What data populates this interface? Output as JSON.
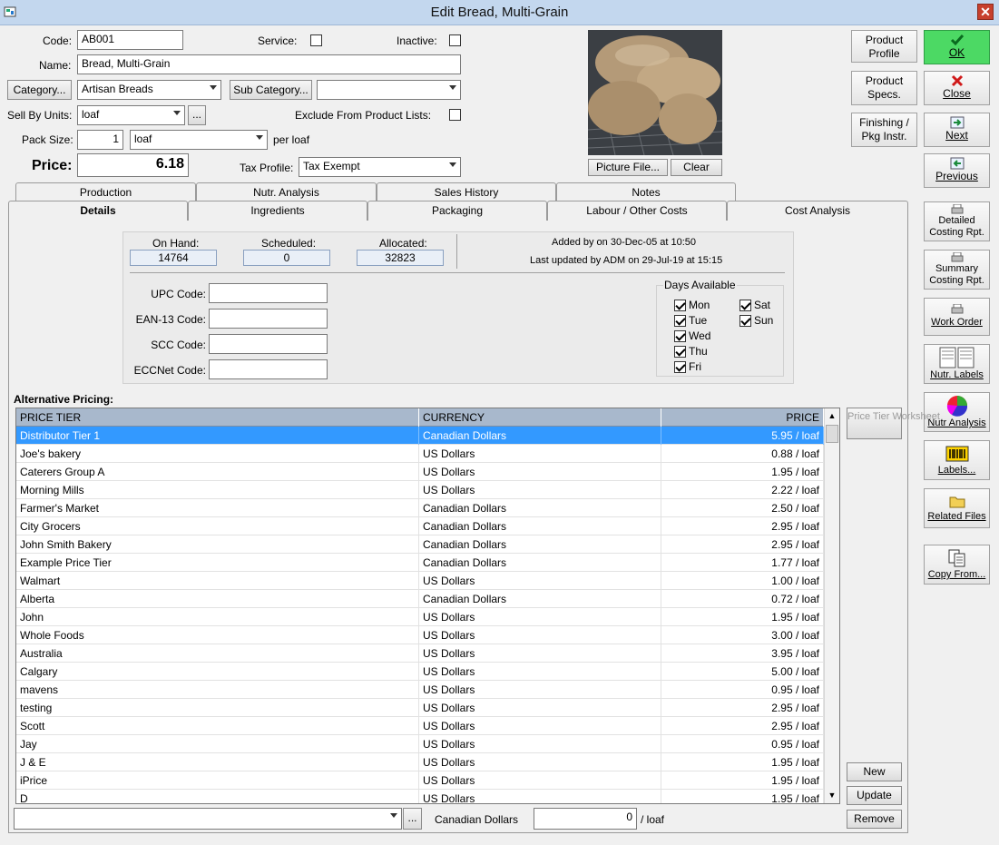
{
  "window": {
    "title": "Edit Bread, Multi-Grain",
    "close_glyph": "✕"
  },
  "form": {
    "code_label": "Code:",
    "code_value": "AB001",
    "service_label": "Service:",
    "inactive_label": "Inactive:",
    "name_label": "Name:",
    "name_value": "Bread, Multi-Grain",
    "category_button": "Category...",
    "category_value": "Artisan Breads",
    "subcategory_button": "Sub Category...",
    "subcategory_value": "",
    "sell_by_label": "Sell By Units:",
    "sell_by_value": "loaf",
    "ellipsis": "...",
    "exclude_label": "Exclude From Product Lists:",
    "pack_size_label": "Pack Size:",
    "pack_size_value": "1",
    "pack_unit_value": "loaf",
    "per_label": "per loaf",
    "price_label": "Price:",
    "price_value": "6.18",
    "tax_label": "Tax Profile:",
    "tax_value": "Tax Exempt",
    "picture_file_button": "Picture File...",
    "clear_button": "Clear"
  },
  "actions": {
    "product_profile": "Product Profile",
    "product_specs": "Product Specs.",
    "finishing": "Finishing / Pkg Instr.",
    "ok": "OK",
    "close": "Close",
    "next": "Next",
    "previous": "Previous",
    "detailed_costing": "Detailed Costing Rpt.",
    "summary_costing": "Summary Costing Rpt.",
    "work_order": "Work Order",
    "nutr_labels": "Nutr. Labels",
    "nutr_analysis": "Nutr Analysis",
    "labels": "Labels...",
    "related_files": "Related Files",
    "copy_from": "Copy From..."
  },
  "tabs_back": [
    "Production",
    "Nutr. Analysis",
    "Sales History",
    "Notes"
  ],
  "tabs_front": [
    "Details",
    "Ingredients",
    "Packaging",
    "Labour / Other Costs",
    "Cost Analysis"
  ],
  "details": {
    "on_hand_label": "On Hand:",
    "on_hand_value": "14764",
    "scheduled_label": "Scheduled:",
    "scheduled_value": "0",
    "allocated_label": "Allocated:",
    "allocated_value": "32823",
    "added_text": "Added by  on 30-Dec-05 at 10:50",
    "updated_text": "Last updated by ADM on 29-Jul-19 at 15:15",
    "upc_label": "UPC Code:",
    "ean_label": "EAN-13 Code:",
    "scc_label": "SCC Code:",
    "eccnet_label": "ECCNet Code:",
    "days_title": "Days Available",
    "days": [
      {
        "label": "Mon",
        "checked": true
      },
      {
        "label": "Tue",
        "checked": true
      },
      {
        "label": "Wed",
        "checked": true
      },
      {
        "label": "Thu",
        "checked": true
      },
      {
        "label": "Fri",
        "checked": true
      },
      {
        "label": "Sat",
        "checked": true
      },
      {
        "label": "Sun",
        "checked": true
      }
    ]
  },
  "pricing": {
    "section_label": "Alternative Pricing:",
    "columns": [
      "PRICE TIER",
      "CURRENCY",
      "PRICE"
    ],
    "rows": [
      {
        "tier": "Distributor Tier 1",
        "currency": "Canadian Dollars",
        "price": "5.95 / loaf"
      },
      {
        "tier": "Joe's bakery",
        "currency": "US Dollars",
        "price": "0.88 / loaf"
      },
      {
        "tier": "Caterers Group A",
        "currency": "US Dollars",
        "price": "1.95 / loaf"
      },
      {
        "tier": "Morning Mills",
        "currency": "US Dollars",
        "price": "2.22 / loaf"
      },
      {
        "tier": "Farmer's Market",
        "currency": "Canadian Dollars",
        "price": "2.50 / loaf"
      },
      {
        "tier": "City Grocers",
        "currency": "Canadian Dollars",
        "price": "2.95 / loaf"
      },
      {
        "tier": "John Smith Bakery",
        "currency": "Canadian Dollars",
        "price": "2.95 / loaf"
      },
      {
        "tier": "Example Price Tier",
        "currency": "Canadian Dollars",
        "price": "1.77 / loaf"
      },
      {
        "tier": "Walmart",
        "currency": "US Dollars",
        "price": "1.00 / loaf"
      },
      {
        "tier": "Alberta",
        "currency": "Canadian Dollars",
        "price": "0.72 / loaf"
      },
      {
        "tier": "John",
        "currency": "US Dollars",
        "price": "1.95 / loaf"
      },
      {
        "tier": "Whole Foods",
        "currency": "US Dollars",
        "price": "3.00 / loaf"
      },
      {
        "tier": "Australia",
        "currency": "US Dollars",
        "price": "3.95 / loaf"
      },
      {
        "tier": "Calgary",
        "currency": "US Dollars",
        "price": "5.00 / loaf"
      },
      {
        "tier": "mavens",
        "currency": "US Dollars",
        "price": "0.95 / loaf"
      },
      {
        "tier": "testing",
        "currency": "US Dollars",
        "price": "2.95 / loaf"
      },
      {
        "tier": "Scott",
        "currency": "US Dollars",
        "price": "2.95 / loaf"
      },
      {
        "tier": "Jay",
        "currency": "US Dollars",
        "price": "0.95 / loaf"
      },
      {
        "tier": "J & E",
        "currency": "US Dollars",
        "price": "1.95 / loaf"
      },
      {
        "tier": "iPrice",
        "currency": "US Dollars",
        "price": "1.95 / loaf"
      },
      {
        "tier": "D",
        "currency": "US Dollars",
        "price": "1.95 / loaf"
      }
    ],
    "worksheet_button": "Price Tier Worksheet",
    "new_button": "New",
    "update_button": "Update",
    "remove_button": "Remove",
    "bottom_currency": "Canadian Dollars",
    "bottom_price": "0",
    "bottom_unit": "/ loaf"
  },
  "colors": {
    "ok_green": "#4cd964",
    "selection_blue": "#3399ff",
    "header_blue": "#a8b8cc"
  }
}
